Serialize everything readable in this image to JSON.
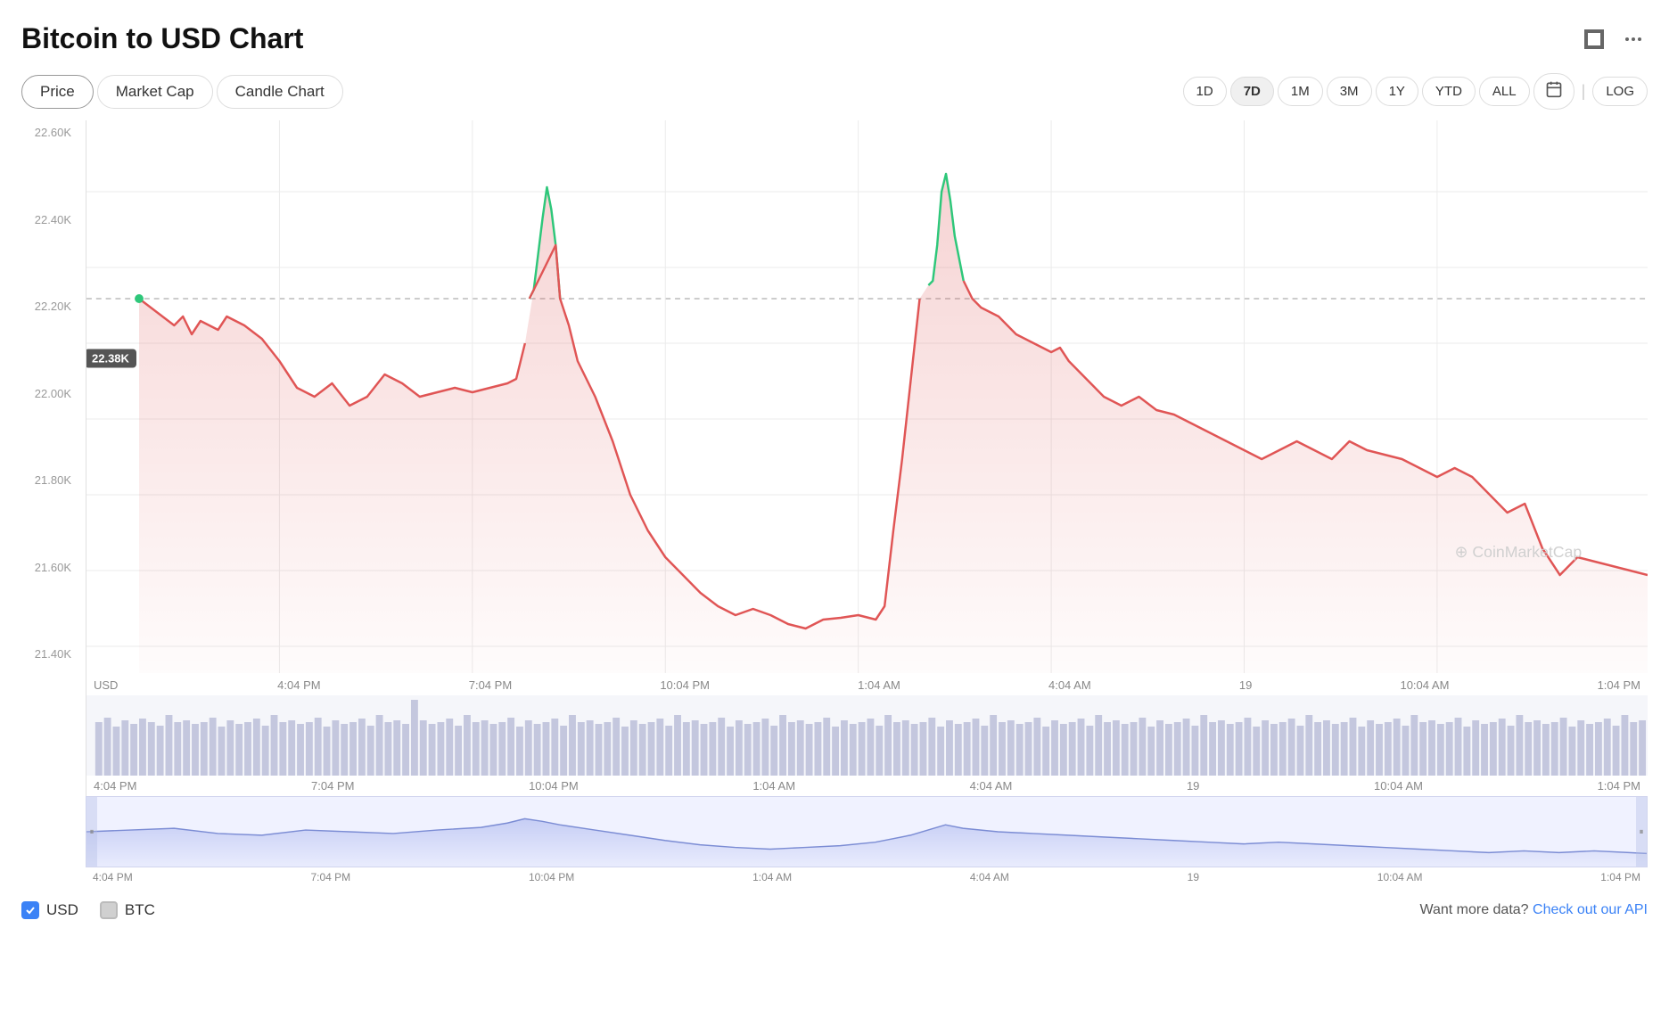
{
  "page": {
    "title": "Bitcoin to USD Chart",
    "expand_icon": "⛶",
    "more_icon": "⋯"
  },
  "tabs": [
    {
      "label": "Price",
      "active": true
    },
    {
      "label": "Market Cap",
      "active": false
    },
    {
      "label": "Candle Chart",
      "active": false
    }
  ],
  "timeframes": [
    {
      "label": "1D",
      "active": false
    },
    {
      "label": "7D",
      "active": true
    },
    {
      "label": "1M",
      "active": false
    },
    {
      "label": "3M",
      "active": false
    },
    {
      "label": "1Y",
      "active": false
    },
    {
      "label": "YTD",
      "active": false
    },
    {
      "label": "ALL",
      "active": false
    }
  ],
  "calendar_icon": "📅",
  "log_button": "LOG",
  "current_price_label": "22.38K",
  "y_axis_labels": [
    "22.60K",
    "22.40K",
    "22.20K",
    "22.00K",
    "21.80K",
    "21.60K",
    "21.40K"
  ],
  "x_axis_labels": [
    "4:04 PM",
    "7:04 PM",
    "10:04 PM",
    "1:04 AM",
    "4:04 AM",
    "19",
    "10:04 AM",
    "1:04 PM"
  ],
  "volume_x_labels": [
    "4:04 PM",
    "7:04 PM",
    "10:04 PM",
    "1:04 AM",
    "4:04 AM",
    "19",
    "10:04 AM",
    "1:04 PM"
  ],
  "mini_x_labels": [
    "4:04 PM",
    "7:04 PM",
    "10:04 PM",
    "1:04 AM",
    "4:04 AM",
    "19",
    "10:04 AM",
    "1:04 PM"
  ],
  "watermark": "CoinMarketCap",
  "legend": {
    "usd_label": "USD",
    "btc_label": "BTC",
    "api_text": "Want more data?",
    "api_link": "Check out our API"
  },
  "colors": {
    "line_red": "#e05555",
    "line_green": "#2ec77a",
    "fill_red": "rgba(220,80,80,0.15)",
    "accent_blue": "#3b82f6",
    "grid_line": "#e8e8e8",
    "dotted_line": "#bbb",
    "volume_bar": "#c8cde8",
    "mini_line": "#7b8cd4"
  }
}
